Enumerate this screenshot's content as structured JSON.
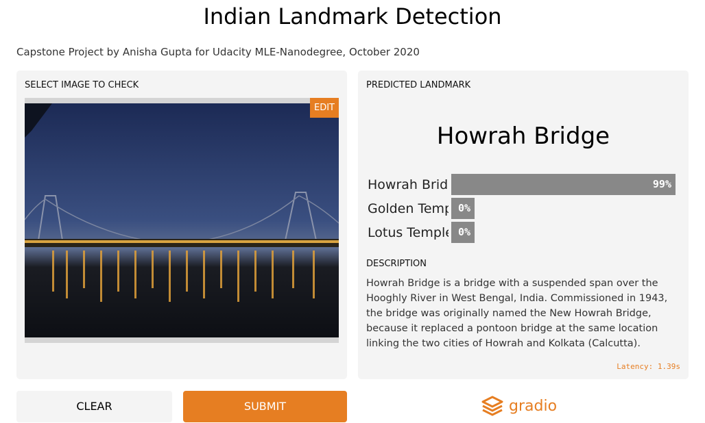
{
  "header": {
    "title": "Indian Landmark Detection",
    "subtitle": "Capstone Project by Anisha Gupta for Udacity MLE-Nanodegree, October 2020"
  },
  "input": {
    "label": "SELECT IMAGE TO CHECK",
    "edit_label": "EDIT"
  },
  "output": {
    "label": "PREDICTED LANDMARK",
    "prediction": "Howrah Bridge",
    "confidences": [
      {
        "label": "Howrah Bridge",
        "value": 0.99,
        "display": "99%"
      },
      {
        "label": "Golden Temple",
        "value": 0.0,
        "display": "0%"
      },
      {
        "label": "Lotus Temple",
        "value": 0.0,
        "display": "0%"
      }
    ],
    "description_label": "DESCRIPTION",
    "description": "Howrah Bridge is a bridge with a suspended span over the Hooghly River in West Bengal, India. Commissioned in 1943, the bridge was originally named the New Howrah Bridge, because it replaced a pontoon bridge at the same location linking the two cities of Howrah and Kolkata (Calcutta).",
    "latency": "Latency: 1.39s"
  },
  "buttons": {
    "clear": "CLEAR",
    "submit": "SUBMIT"
  },
  "footer": {
    "brand": "gradio"
  },
  "colors": {
    "accent": "#e67e22",
    "panel": "#f4f4f4",
    "bar": "#888888"
  }
}
